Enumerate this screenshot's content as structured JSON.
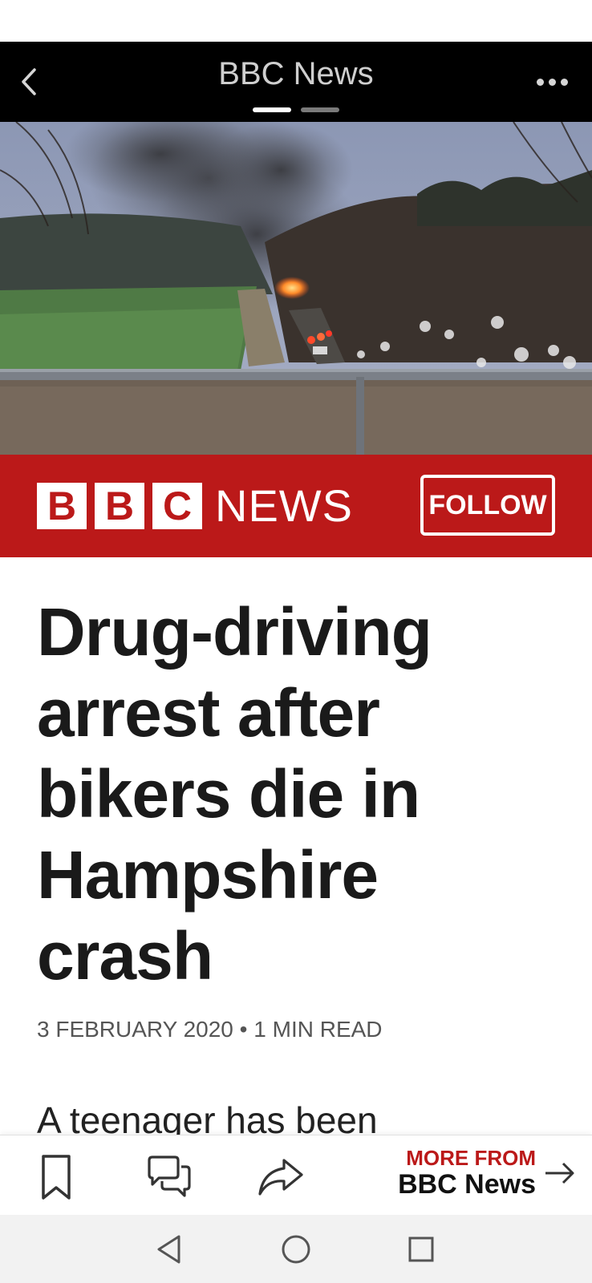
{
  "topbar": {
    "title": "BBC News",
    "back_icon": "chevron-left-icon",
    "more_icon": "more-horizontal-icon",
    "pages": 2,
    "active_page": 1
  },
  "hero": {
    "image": "photo of smoke rising above a burning crash site on a rural road beside fields and woodland"
  },
  "brand": {
    "logo_letters": [
      "B",
      "B",
      "C"
    ],
    "logo_word": "NEWS",
    "follow_label": "FOLLOW",
    "color": "#bb1919"
  },
  "article": {
    "headline_lines": [
      "Drug-driving",
      "arrest after",
      "bikers die in",
      "Hampshire",
      "crash"
    ],
    "date": "3 FEBRUARY 2020",
    "separator": "•",
    "read_time": "1 MIN READ",
    "body_start": "A teenager has been"
  },
  "toolbar": {
    "bookmark_icon": "bookmark-icon",
    "comment_icon": "comment-icon",
    "share_icon": "share-icon",
    "more_from_label": "MORE FROM",
    "more_from_source": "BBC News",
    "arrow_icon": "arrow-right-icon"
  },
  "nav": {
    "back_icon": "triangle-back-icon",
    "home_icon": "circle-home-icon",
    "recents_icon": "square-recents-icon"
  }
}
